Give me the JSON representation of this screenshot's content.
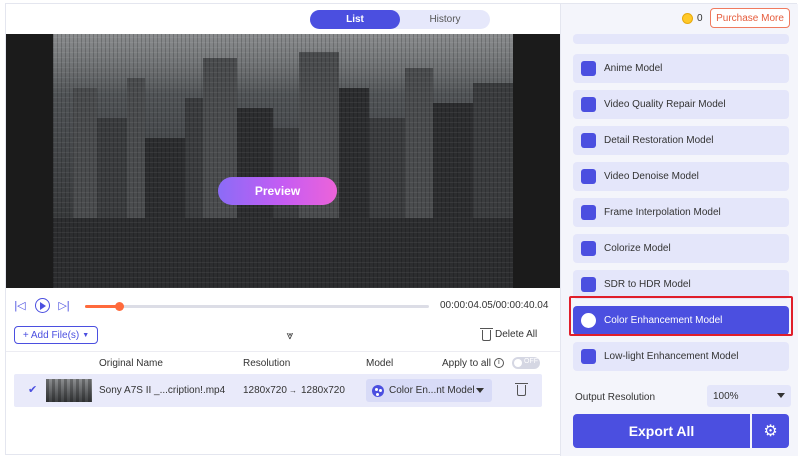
{
  "tabs": [
    {
      "label": "List",
      "active": true
    },
    {
      "label": "History",
      "active": false
    }
  ],
  "header": {
    "coins": "0",
    "purchase_label": "Purchase More"
  },
  "preview": {
    "button_label": "Preview"
  },
  "player": {
    "time": "00:00:04.05/00:00:40.04",
    "progress": 0.1
  },
  "file_toolbar": {
    "add_files_label": "+ Add File(s)",
    "delete_all_label": "Delete All"
  },
  "table": {
    "headers": {
      "original_name": "Original Name",
      "resolution": "Resolution",
      "model": "Model",
      "apply_to_all": "Apply to all",
      "toggle": "OFF"
    },
    "rows": [
      {
        "name": "Sony A7S II _...cription!.mp4",
        "res_from": "1280x720",
        "arrow": "→",
        "res_to": "1280x720",
        "model": "Color En...nt Model"
      }
    ]
  },
  "models": [
    {
      "label": "Anime Model",
      "icon": "anime-icon"
    },
    {
      "label": "Video Quality Repair Model",
      "icon": "video-repair-icon"
    },
    {
      "label": "Detail Restoration Model",
      "icon": "detail-icon"
    },
    {
      "label": "Video Denoise Model",
      "icon": "denoise-icon"
    },
    {
      "label": "Frame Interpolation Model",
      "icon": "frame-icon"
    },
    {
      "label": "Colorize Model",
      "icon": "colorize-icon"
    },
    {
      "label": "SDR to HDR Model",
      "icon": "hdr-icon"
    },
    {
      "label": "Color Enhancement Model",
      "icon": "palette-icon",
      "selected": true
    },
    {
      "label": "Low-light Enhancement Model",
      "icon": "moon-icon"
    }
  ],
  "output": {
    "label": "Output Resolution",
    "value": "100%"
  },
  "export_label": "Export All",
  "colors": {
    "accent": "#4b4fe0",
    "progress": "#ff6a3c",
    "highlight": "#e01e2a"
  }
}
